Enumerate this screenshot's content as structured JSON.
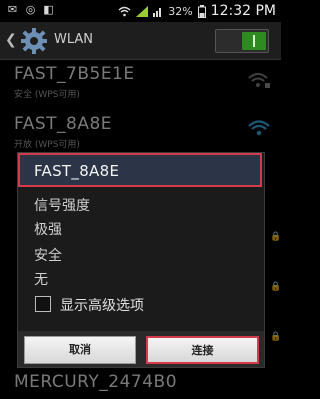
{
  "status": {
    "time": "12:32 PM",
    "battery": "32%",
    "icons": [
      "mail-icon",
      "vibrate-icon",
      "gallery-icon",
      "wifi-signal-icon",
      "battery-icon"
    ]
  },
  "header": {
    "title": "WLAN",
    "toggle_on": true
  },
  "networks": [
    {
      "ssid": "FAST_7B5E1E",
      "sub": "安全 (WPS可用)"
    },
    {
      "ssid": "FAST_8A8E",
      "sub": "开放 (WPS可用)"
    },
    {
      "ssid": "MERCURY_2474B0",
      "sub": ""
    }
  ],
  "dialog": {
    "title": "FAST_8A8E",
    "signal_label": "信号强度",
    "signal_value": "极强",
    "security_label": "安全",
    "security_value": "无",
    "advanced_label": "显示高级选项",
    "cancel": "取消",
    "connect": "连接"
  }
}
